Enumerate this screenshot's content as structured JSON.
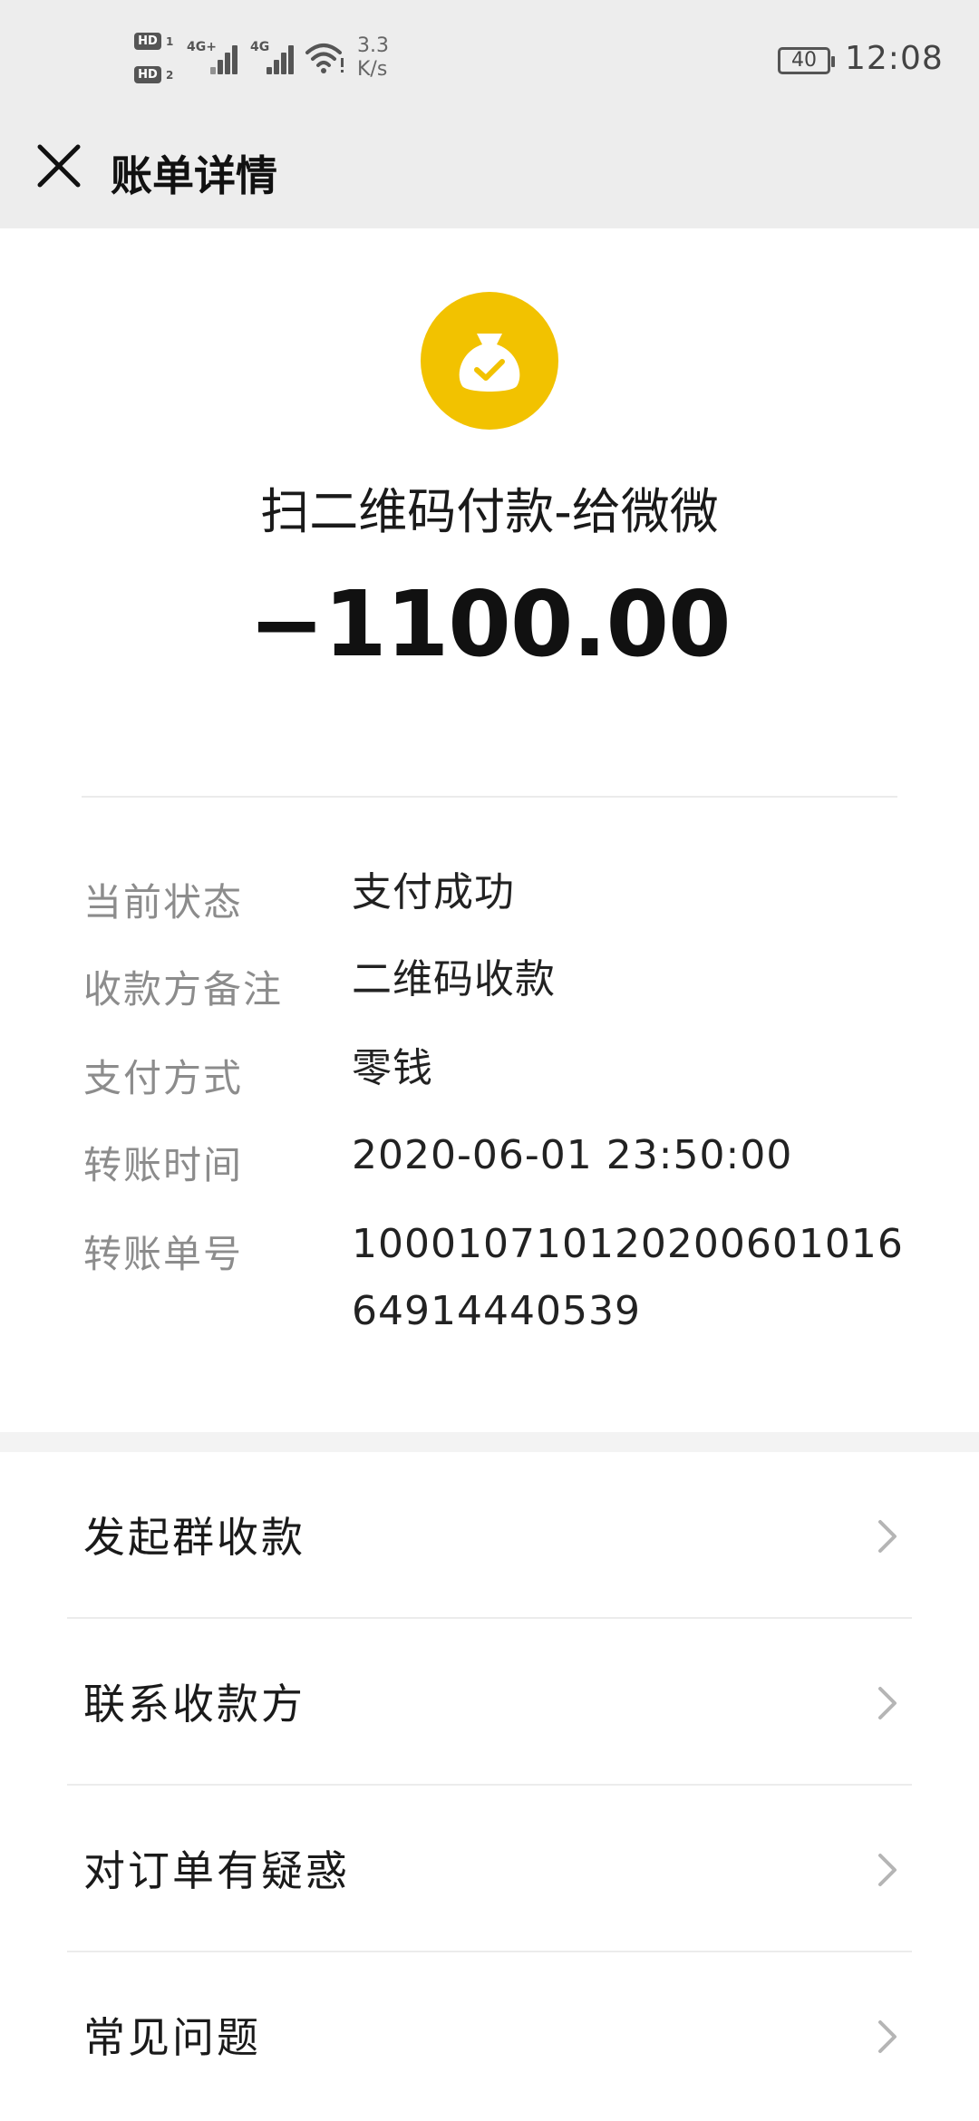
{
  "status_bar": {
    "hd1": "HD",
    "hd1_sub": "1",
    "hd2": "HD",
    "hd2_sub": "2",
    "net1": "4G+",
    "net2": "4G",
    "speed_value": "3.3",
    "speed_unit": "K/s",
    "battery": "40",
    "time": "12:08"
  },
  "title_bar": {
    "close_icon": "close-icon",
    "title": "账单详情"
  },
  "header": {
    "icon": "money-bag-check-icon",
    "icon_color": "#f2c200",
    "payee_title": "扫二维码付款-给微微",
    "amount": "−1100.00"
  },
  "details": [
    {
      "label": "当前状态",
      "value": "支付成功"
    },
    {
      "label": "收款方备注",
      "value": "二维码收款"
    },
    {
      "label": "支付方式",
      "value": "零钱"
    },
    {
      "label": "转账时间",
      "value": "2020-06-01 23:50:00"
    },
    {
      "label": "转账单号",
      "value": "100010710120200601016 64914440539"
    }
  ],
  "menu": [
    {
      "label": "发起群收款",
      "icon": "chevron-right-icon"
    },
    {
      "label": "联系收款方",
      "icon": "chevron-right-icon"
    },
    {
      "label": "对订单有疑惑",
      "icon": "chevron-right-icon"
    },
    {
      "label": "常见问题",
      "icon": "chevron-right-icon"
    }
  ]
}
